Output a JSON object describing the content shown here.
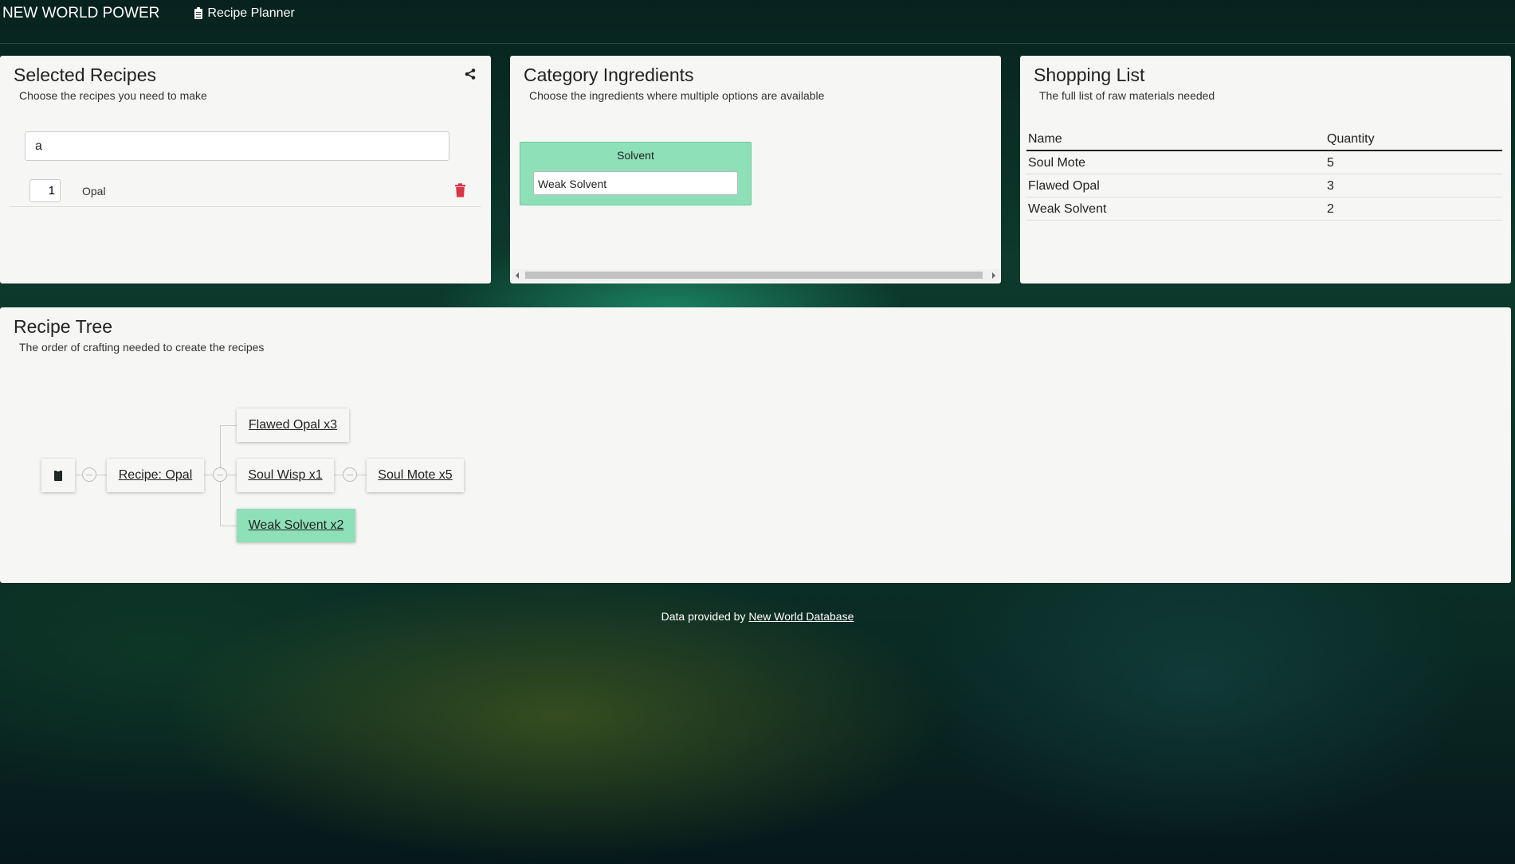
{
  "navbar": {
    "brand": "NEW WORLD POWER",
    "link_label": "Recipe Planner"
  },
  "selected_recipes": {
    "title": "Selected Recipes",
    "subtitle": "Choose the recipes you need to make",
    "search_value": "a",
    "items": [
      {
        "quantity": "1",
        "name": "Opal"
      }
    ]
  },
  "category_ingredients": {
    "title": "Category Ingredients",
    "subtitle": "Choose the ingredients where multiple options are available",
    "categories": [
      {
        "label": "Solvent",
        "selected": "Weak Solvent"
      }
    ]
  },
  "shopping_list": {
    "title": "Shopping List",
    "subtitle": "The full list of raw materials needed",
    "columns": [
      "Name",
      "Quantity"
    ],
    "rows": [
      {
        "name": "Soul Mote",
        "quantity": "5"
      },
      {
        "name": "Flawed Opal",
        "quantity": "3"
      },
      {
        "name": "Weak Solvent",
        "quantity": "2"
      }
    ]
  },
  "recipe_tree": {
    "title": "Recipe Tree",
    "subtitle": "The order of crafting needed to create the recipes",
    "nodes": {
      "root": "Recipe: Opal",
      "child_1": "Flawed Opal x3",
      "child_2": "Soul Wisp x1",
      "grandchild": "Soul Mote x5",
      "child_3": "Weak Solvent x2"
    },
    "highlight_color": "#8ee0b8"
  },
  "footer": {
    "prefix": "Data provided by",
    "link": "New World Database"
  },
  "colors": {
    "accent_green": "#8ee0b8",
    "danger_red": "#dc3545",
    "panel_bg": "#f6f6f4"
  }
}
